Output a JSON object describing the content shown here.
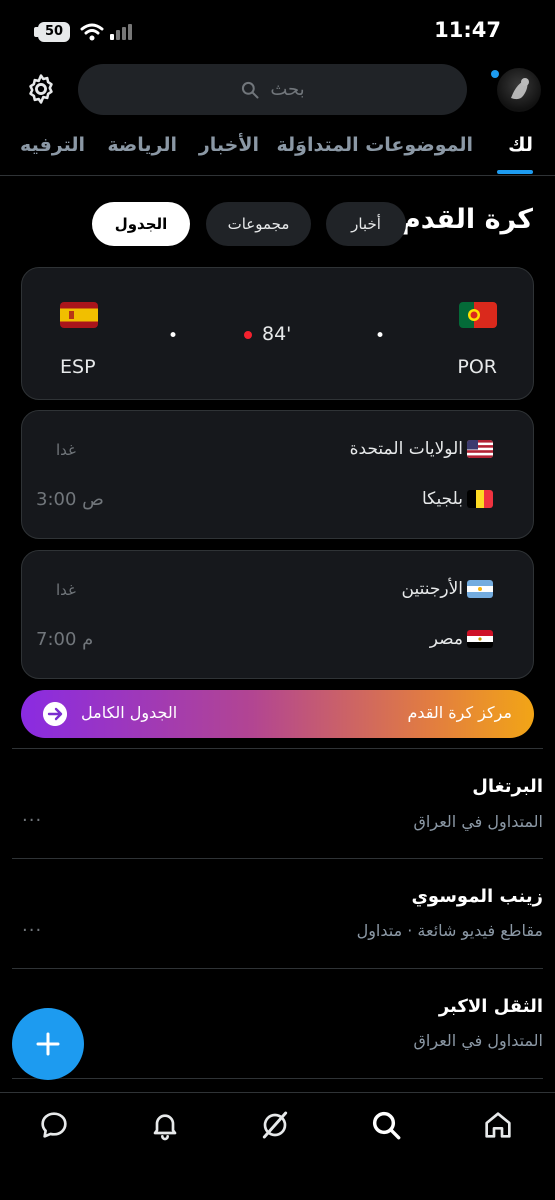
{
  "status_bar": {
    "time": "11:47",
    "battery": "50"
  },
  "search": {
    "placeholder": "بحث"
  },
  "tabs": [
    {
      "label": "لك",
      "active": true
    },
    {
      "label": "الموضوعات المتداوَلة",
      "active": false
    },
    {
      "label": "الأخبار",
      "active": false
    },
    {
      "label": "الرياضة",
      "active": false
    },
    {
      "label": "الترفيه",
      "active": false
    }
  ],
  "section": {
    "title": "كرة القدم",
    "chips": [
      {
        "label": "أخبار",
        "active": false
      },
      {
        "label": "مجموعات",
        "active": false
      },
      {
        "label": "الجدول",
        "active": true
      }
    ]
  },
  "live_match": {
    "home_code": "POR",
    "away_code": "ESP",
    "home_score": "•",
    "away_score": "•",
    "minute": "84'"
  },
  "fixtures": [
    {
      "team1": "الولايات المتحدة",
      "team2": "بلجيكا",
      "day": "غدا",
      "time": "3:00 ص"
    },
    {
      "team1": "الأرجنتين",
      "team2": "مصر",
      "day": "غدا",
      "time": "7:00 م"
    }
  ],
  "banner": {
    "right_label": "مركز كرة القدم",
    "left_label": "الجدول الكامل"
  },
  "trends": [
    {
      "title": "البرتغال",
      "subtitle": "المتداول في العراق",
      "more": "···"
    },
    {
      "title": "زينب الموسوي",
      "subtitle": "مقاطع فيديو شائعة · متداول",
      "more": "···"
    },
    {
      "title": "الثقل الاكبر",
      "subtitle": "المتداول في العراق",
      "more": "···"
    }
  ],
  "colors": {
    "accent": "#1d9bf0",
    "live": "#f4212e",
    "background": "#000000",
    "card": "#16181c"
  }
}
